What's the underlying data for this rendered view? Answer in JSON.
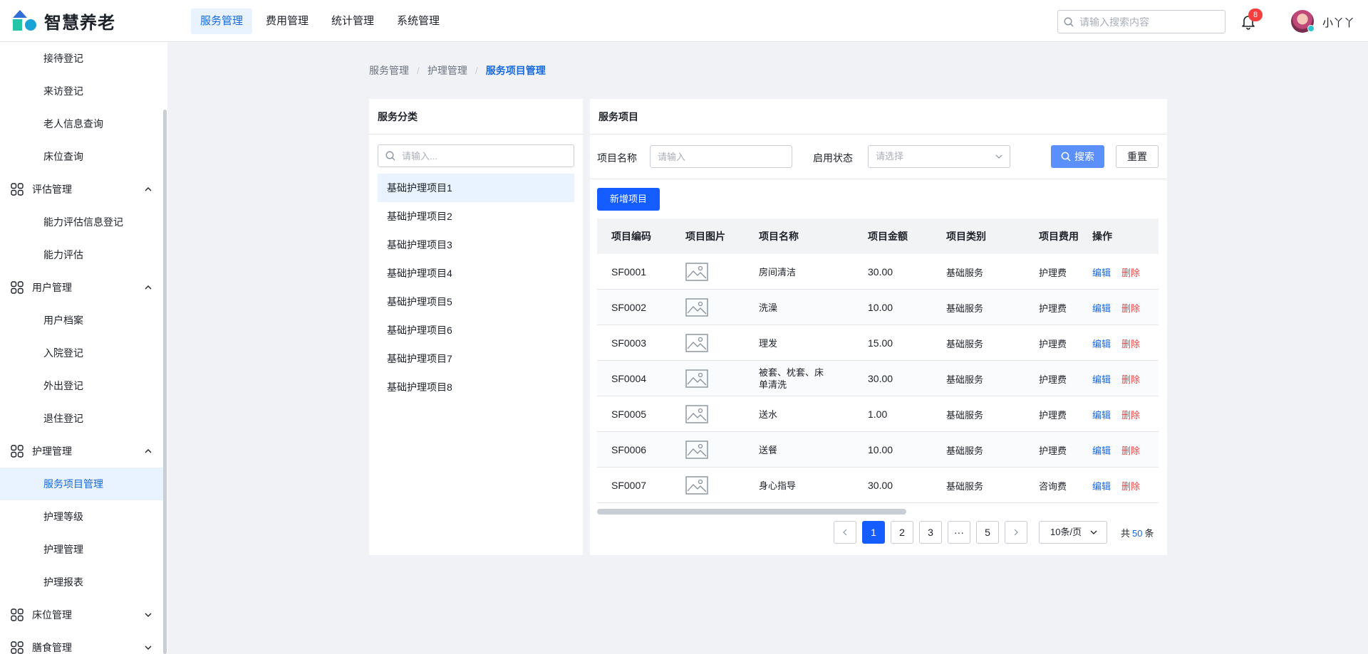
{
  "app": {
    "title": "智慧养老"
  },
  "topnav": [
    "服务管理",
    "费用管理",
    "统计管理",
    "系统管理"
  ],
  "header": {
    "search_placeholder": "请输入搜索内容",
    "notifications": "8",
    "username": "小丫丫"
  },
  "sidebar": [
    {
      "type": "sub",
      "label": "接待登记"
    },
    {
      "type": "sub",
      "label": "来访登记"
    },
    {
      "type": "sub",
      "label": "老人信息查询"
    },
    {
      "type": "sub",
      "label": "床位查询"
    },
    {
      "type": "group",
      "label": "评估管理",
      "expanded": true
    },
    {
      "type": "sub",
      "label": "能力评估信息登记"
    },
    {
      "type": "sub",
      "label": "能力评估"
    },
    {
      "type": "group",
      "label": "用户管理",
      "expanded": true
    },
    {
      "type": "sub",
      "label": "用户档案"
    },
    {
      "type": "sub",
      "label": "入院登记"
    },
    {
      "type": "sub",
      "label": "外出登记"
    },
    {
      "type": "sub",
      "label": "退住登记"
    },
    {
      "type": "group",
      "label": "护理管理",
      "expanded": true
    },
    {
      "type": "sub",
      "label": "服务项目管理",
      "active": true
    },
    {
      "type": "sub",
      "label": "护理等级"
    },
    {
      "type": "sub",
      "label": "护理管理"
    },
    {
      "type": "sub",
      "label": "护理报表"
    },
    {
      "type": "group",
      "label": "床位管理",
      "expanded": false
    },
    {
      "type": "group",
      "label": "膳食管理",
      "expanded": false
    }
  ],
  "breadcrumb": [
    "服务管理",
    "护理管理",
    "服务项目管理"
  ],
  "category_panel": {
    "title": "服务分类",
    "search_placeholder": "请输入...",
    "items": [
      "基础护理项目1",
      "基础护理项目2",
      "基础护理项目3",
      "基础护理项目4",
      "基础护理项目5",
      "基础护理项目6",
      "基础护理项目7",
      "基础护理项目8"
    ]
  },
  "main_panel": {
    "title": "服务项目",
    "filter": {
      "name_label": "项目名称",
      "name_placeholder": "请输入",
      "status_label": "启用状态",
      "status_placeholder": "请选择",
      "search_button": "搜索",
      "reset_button": "重置"
    },
    "add_button": "新增项目",
    "columns": [
      "项目编码",
      "项目图片",
      "项目名称",
      "项目金额",
      "项目类别",
      "项目费用",
      "操作"
    ],
    "rows": [
      {
        "code": "SF0001",
        "name": "房间清洁",
        "amount": "30.00",
        "category": "基础服务",
        "fee": "护理费"
      },
      {
        "code": "SF0002",
        "name": "洗澡",
        "amount": "10.00",
        "category": "基础服务",
        "fee": "护理费"
      },
      {
        "code": "SF0003",
        "name": "理发",
        "amount": "15.00",
        "category": "基础服务",
        "fee": "护理费"
      },
      {
        "code": "SF0004",
        "name": "被套、枕套、床单清洗",
        "amount": "30.00",
        "category": "基础服务",
        "fee": "护理费"
      },
      {
        "code": "SF0005",
        "name": "送水",
        "amount": "1.00",
        "category": "基础服务",
        "fee": "护理费"
      },
      {
        "code": "SF0006",
        "name": "送餐",
        "amount": "10.00",
        "category": "基础服务",
        "fee": "护理费"
      },
      {
        "code": "SF0007",
        "name": "身心指导",
        "amount": "30.00",
        "category": "基础服务",
        "fee": "咨询费"
      }
    ],
    "actions": {
      "edit": "编辑",
      "delete": "删除"
    },
    "pagination": {
      "pages": [
        "1",
        "2",
        "3",
        "···",
        "5"
      ],
      "current": "1",
      "page_size": "10条/页",
      "total_prefix": "共",
      "total": "50",
      "total_suffix": "条"
    }
  },
  "colors": {
    "primary": "#165dff",
    "link": "#1668dc",
    "danger": "#f53f3f",
    "active_bg": "#e8f3ff"
  }
}
